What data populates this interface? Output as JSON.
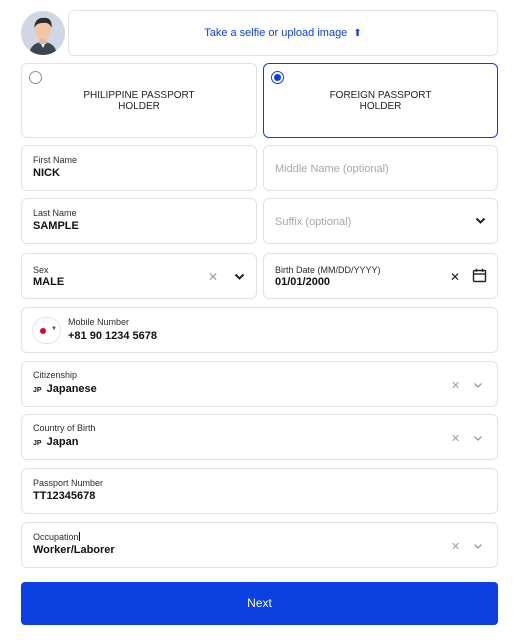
{
  "selfie": {
    "text": "Take a selfie or upload image"
  },
  "holder_options": [
    {
      "label_line1": "PHILIPPINE PASSPORT",
      "label_line2": "HOLDER",
      "selected": false
    },
    {
      "label_line1": "FOREIGN PASSPORT",
      "label_line2": "HOLDER",
      "selected": true
    }
  ],
  "fields": {
    "first_name": {
      "label": "First Name",
      "value": "NICK"
    },
    "middle_name": {
      "placeholder": "Middle Name (optional)"
    },
    "last_name": {
      "label": "Last Name",
      "value": "SAMPLE"
    },
    "suffix": {
      "placeholder": "Suffix (optional)"
    },
    "sex": {
      "label": "Sex",
      "value": "MALE"
    },
    "birth_date": {
      "label": "Birth Date (MM/DD/YYYY)",
      "value": "01/01/2000"
    },
    "mobile": {
      "label": "Mobile Number",
      "value": "+81 90 1234 5678"
    },
    "citizenship": {
      "label": "Citizenship",
      "code": "JP",
      "value": "Japanese"
    },
    "country_of_birth": {
      "label": "Country of Birth",
      "code": "JP",
      "value": "Japan"
    },
    "passport_number": {
      "label": "Passport Number",
      "value": "TT12345678"
    },
    "occupation": {
      "label": "Occupation",
      "value": "Worker/Laborer"
    }
  },
  "next_button": {
    "label": "Next"
  },
  "colors": {
    "accent": "#0a3fe0",
    "border": "#dfe3e8",
    "flag_red": "#e6002d"
  }
}
